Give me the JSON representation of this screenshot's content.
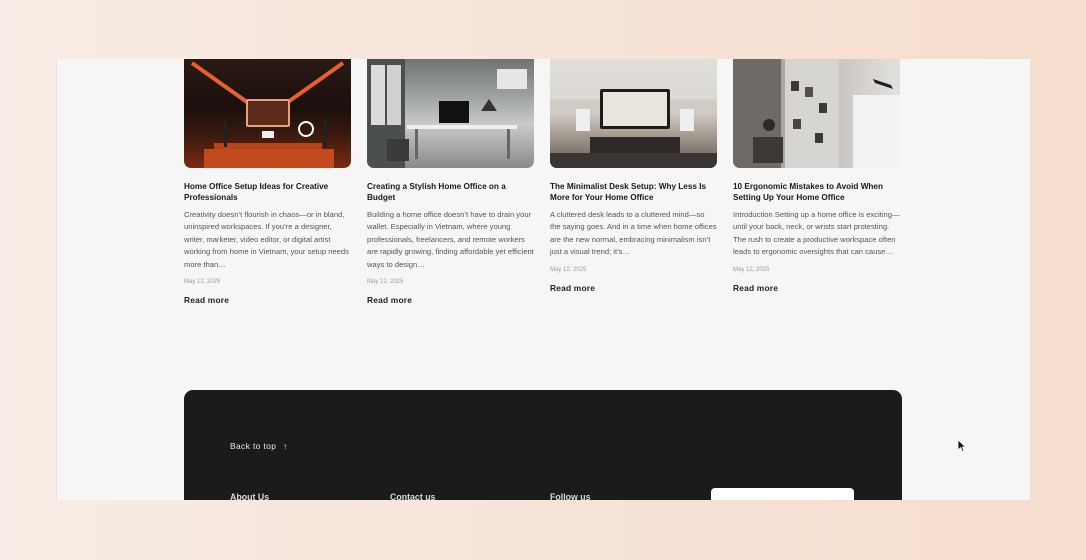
{
  "cards": [
    {
      "title": "Home Office Setup Ideas for Creative Professionals",
      "excerpt": "Creativity doesn’t flourish in chaos—or in bland, uninspired workspaces. If you’re a designer, writer, marketer, video editor, or digital artist working from home in Vietnam, your setup needs more than…",
      "date": "May 12, 2025",
      "read_more": "Read more"
    },
    {
      "title": "Creating a Stylish Home Office on a Budget",
      "excerpt": "Building a home office doesn’t have to drain your wallet. Especially in Vietnam, where young professionals, freelancers, and remote workers are rapidly growing, finding affordable yet efficient ways to design…",
      "date": "May 12, 2025",
      "read_more": "Read more"
    },
    {
      "title": "The Minimalist Desk Setup: Why Less Is More for Your Home Office",
      "excerpt": "A cluttered desk leads to a cluttered mind—so the saying goes. And in a time when home offices are the new normal, embracing minimalism isn’t just a visual trend; it’s…",
      "date": "May 12, 2025",
      "read_more": "Read more"
    },
    {
      "title": "10 Ergonomic Mistakes to Avoid When Setting Up Your Home Office",
      "excerpt": "Introduction Setting up a home office is exciting—until your back, neck, or wrists start protesting. The rush to create a productive workspace often leads to ergonomic oversights that can cause…",
      "date": "May 12, 2025",
      "read_more": "Read more"
    }
  ],
  "footer": {
    "back_to_top": "Back to top",
    "back_to_top_arrow": "↑",
    "columns": [
      "About Us",
      "Contact us",
      "Follow us"
    ]
  },
  "colors": {
    "page_background": "#f6ddcd",
    "content_background": "#f6f6f6",
    "footer_background": "#1b1b1b"
  }
}
